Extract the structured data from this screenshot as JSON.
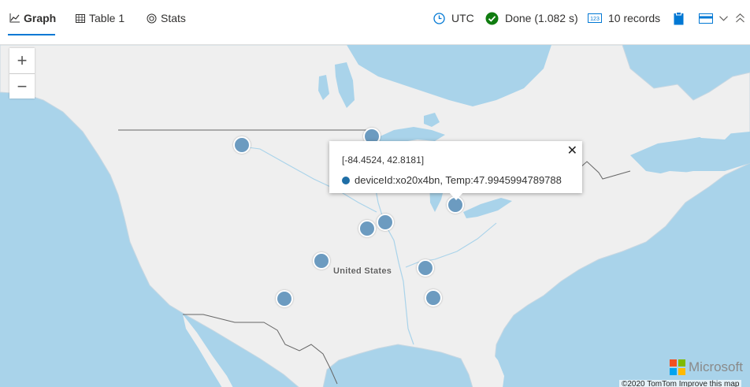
{
  "tabs": [
    {
      "label": "Graph",
      "icon": "line-chart-icon",
      "active": true
    },
    {
      "label": "Table 1",
      "icon": "table-icon",
      "active": false
    },
    {
      "label": "Stats",
      "icon": "stats-icon",
      "active": false
    }
  ],
  "status": {
    "timezone": "UTC",
    "done_text": "Done (1.082 s)",
    "records_text": "10 records",
    "records_icon_text": "123"
  },
  "map": {
    "zoom_in_label": "+",
    "zoom_out_label": "−",
    "country_label": "United States",
    "popup": {
      "coords": "[-84.4524, 42.8181]",
      "detail": "deviceId:xo20x4bn, Temp:47.9945994789788",
      "close_label": "✕"
    },
    "markers_count": 10,
    "attribution_brand": "Microsoft",
    "copyright": "©2020 TomTom  Improve this map"
  },
  "colors": {
    "accent": "#0078d4",
    "water": "#a9d3ea",
    "land": "#efefef",
    "marker": "#6c9bc0",
    "done_green": "#107c10"
  }
}
